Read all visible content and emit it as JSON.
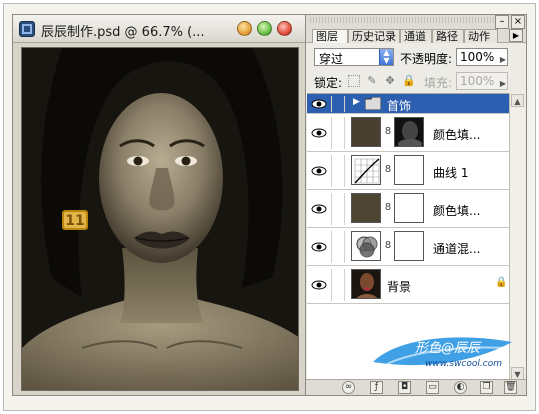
{
  "document": {
    "title": "辰辰制作.psd @ 66.7% (...",
    "badge_text": "11"
  },
  "layers_panel": {
    "tabs": [
      {
        "label": "图层",
        "active": true
      },
      {
        "label": "历史记录",
        "active": false
      },
      {
        "label": "通道",
        "active": false
      },
      {
        "label": "路径",
        "active": false
      },
      {
        "label": "动作",
        "active": false
      }
    ],
    "blend_mode": "穿过",
    "opacity_label": "不透明度:",
    "opacity_value": "100%",
    "lock_label": "锁定:",
    "fill_label": "填充:",
    "fill_value": "100%",
    "layers": [
      {
        "name": "首饰",
        "kind": "group",
        "selected": true
      },
      {
        "name": "颜色填...",
        "kind": "solid-fill",
        "color": "#4a4031"
      },
      {
        "name": "曲线 1",
        "kind": "curves"
      },
      {
        "name": "颜色填...",
        "kind": "solid-fill",
        "color": "#4d4434"
      },
      {
        "name": "通道混...",
        "kind": "channel-mixer"
      },
      {
        "name": "背景",
        "kind": "background"
      }
    ]
  },
  "watermark": {
    "line1": "形色@辰辰",
    "line2": "www.swcool.com"
  },
  "colors": {
    "selection": "#2d5fb0",
    "canvas_bg": "#17150f",
    "skin_tone": "#8a7e68"
  }
}
